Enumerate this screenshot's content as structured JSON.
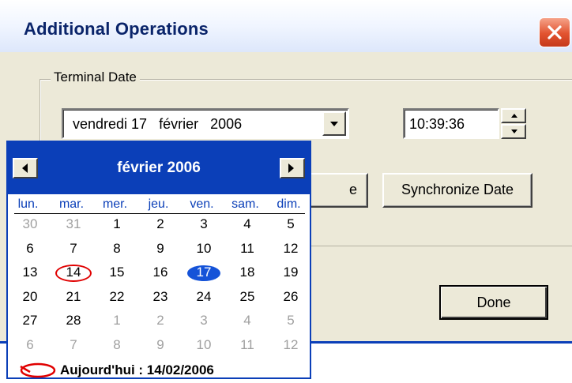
{
  "window": {
    "title": "Additional Operations"
  },
  "group": {
    "label": "Terminal Date"
  },
  "date_picker": {
    "value": "vendredi 17   février   2006"
  },
  "time_picker": {
    "value": "10:39:36"
  },
  "buttons": {
    "hidden_partial": "e",
    "synchronize": "Synchronize Date",
    "done": "Done"
  },
  "calendar": {
    "month_title": "février 2006",
    "weekdays": [
      "lun.",
      "mar.",
      "mer.",
      "jeu.",
      "ven.",
      "sam.",
      "dim."
    ],
    "weeks": [
      [
        {
          "d": "30",
          "o": true
        },
        {
          "d": "31",
          "o": true
        },
        {
          "d": "1"
        },
        {
          "d": "2"
        },
        {
          "d": "3"
        },
        {
          "d": "4"
        },
        {
          "d": "5"
        }
      ],
      [
        {
          "d": "6"
        },
        {
          "d": "7"
        },
        {
          "d": "8"
        },
        {
          "d": "9"
        },
        {
          "d": "10"
        },
        {
          "d": "11"
        },
        {
          "d": "12"
        }
      ],
      [
        {
          "d": "13"
        },
        {
          "d": "14",
          "today": true
        },
        {
          "d": "15"
        },
        {
          "d": "16"
        },
        {
          "d": "17",
          "selected": true
        },
        {
          "d": "18"
        },
        {
          "d": "19"
        }
      ],
      [
        {
          "d": "20"
        },
        {
          "d": "21"
        },
        {
          "d": "22"
        },
        {
          "d": "23"
        },
        {
          "d": "24"
        },
        {
          "d": "25"
        },
        {
          "d": "26"
        }
      ],
      [
        {
          "d": "27"
        },
        {
          "d": "28"
        },
        {
          "d": "1",
          "o": true
        },
        {
          "d": "2",
          "o": true
        },
        {
          "d": "3",
          "o": true
        },
        {
          "d": "4",
          "o": true
        },
        {
          "d": "5",
          "o": true
        }
      ],
      [
        {
          "d": "6",
          "o": true
        },
        {
          "d": "7",
          "o": true
        },
        {
          "d": "8",
          "o": true
        },
        {
          "d": "9",
          "o": true
        },
        {
          "d": "10",
          "o": true
        },
        {
          "d": "11",
          "o": true
        },
        {
          "d": "12",
          "o": true
        }
      ]
    ],
    "today_label": "Aujourd'hui : 14/02/2006"
  },
  "colors": {
    "accent": "#0b3fb8",
    "selected_day": "#1553d8",
    "today_ring": "#e00000",
    "dialog_bg": "#ece9d8"
  },
  "icons": [
    "close-icon",
    "dropdown-arrow-icon",
    "spin-up-icon",
    "spin-down-icon",
    "prev-month-icon",
    "next-month-icon",
    "today-circle-icon"
  ]
}
